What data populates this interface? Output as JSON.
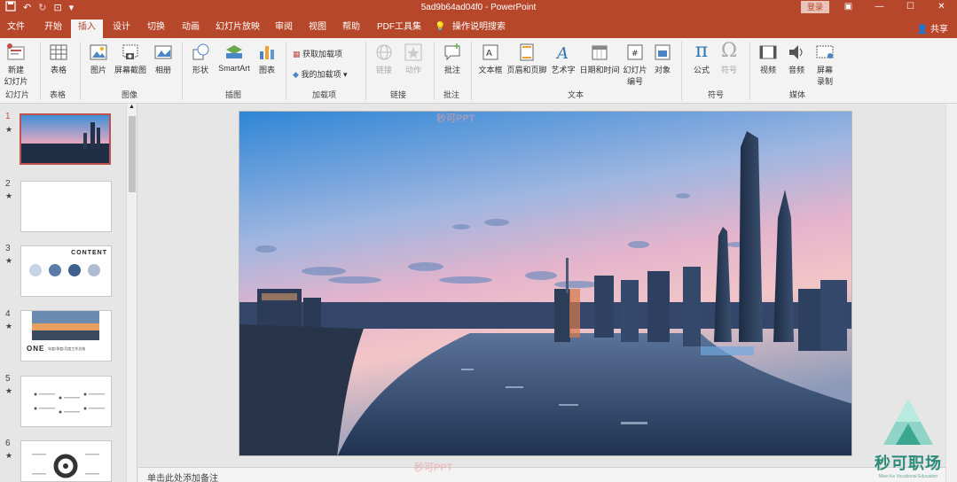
{
  "titlebar": {
    "doc_title": "5ad9b64ad04f0  -  PowerPoint",
    "login": "登录",
    "min": "—",
    "max": "☐",
    "close": "✕",
    "restore_icon": "▣"
  },
  "tabs": [
    {
      "label": "文件"
    },
    {
      "label": "开始"
    },
    {
      "label": "插入"
    },
    {
      "label": "设计"
    },
    {
      "label": "切换"
    },
    {
      "label": "动画"
    },
    {
      "label": "幻灯片放映"
    },
    {
      "label": "审阅"
    },
    {
      "label": "视图"
    },
    {
      "label": "帮助"
    },
    {
      "label": "PDF工具集"
    },
    {
      "label": "操作说明搜索"
    }
  ],
  "share": "共享",
  "ribbon": {
    "new_slide": "新建\n幻灯片",
    "table": "表格",
    "picture": "图片",
    "screenshot": "屏幕截图",
    "album": "相册",
    "shapes": "形状",
    "smartart": "SmartArt",
    "chart": "图表",
    "get_addins": "获取加载项",
    "my_addins": "我的加载项",
    "link": "链接",
    "action": "动作",
    "comment": "批注",
    "textbox": "文本框",
    "header_footer": "页眉和页脚",
    "wordart": "艺术字",
    "datetime": "日期和时间",
    "slide_number": "幻灯片\n编号",
    "object": "对象",
    "equation": "公式",
    "symbol": "符号",
    "video": "视频",
    "audio": "音频",
    "screen_record": "屏幕\n录制",
    "groups": {
      "slides": "幻灯片",
      "tables": "表格",
      "images": "图像",
      "illustrations": "插图",
      "addins": "加载项",
      "links": "链接",
      "comments": "批注",
      "text": "文本",
      "symbols": "符号",
      "media": "媒体"
    }
  },
  "thumbnails": [
    {
      "num": "1",
      "star": "★"
    },
    {
      "num": "2",
      "star": "★"
    },
    {
      "num": "3",
      "star": "★",
      "title": "CONTENT"
    },
    {
      "num": "4",
      "star": "★",
      "title": "ONE",
      "caption": "年度/季度/月度工作总结"
    },
    {
      "num": "5",
      "star": "★"
    },
    {
      "num": "6",
      "star": "★"
    }
  ],
  "notes_placeholder": "单击此处添加备注",
  "watermark": "秒可PPT",
  "brand": {
    "name": "秒可职场",
    "sub": "Miao Ke Vocational Education"
  },
  "colors": {
    "accent": "#b7472a",
    "selected_border": "#c0504d"
  }
}
